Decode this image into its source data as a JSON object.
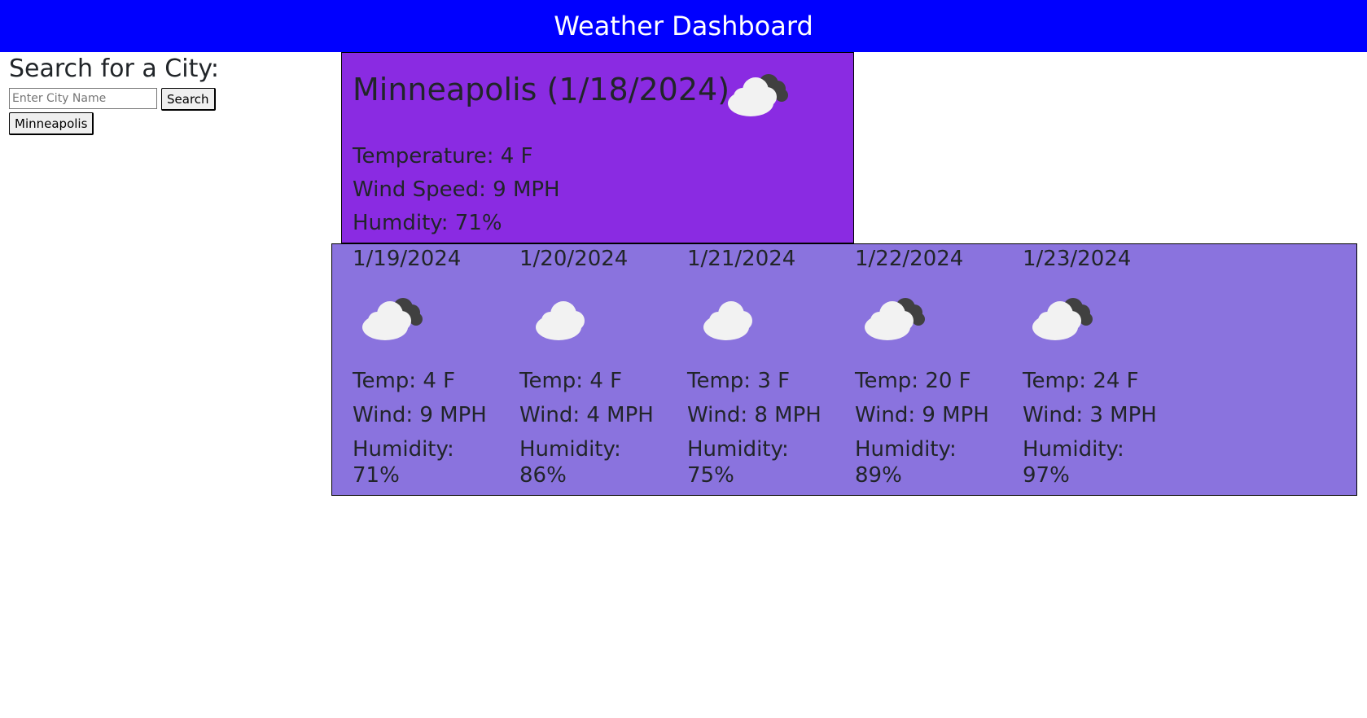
{
  "header": {
    "title": "Weather Dashboard"
  },
  "search": {
    "heading": "Search for a City:",
    "placeholder": "Enter City Name",
    "value": "",
    "button_label": "Search"
  },
  "history": [
    {
      "label": "Minneapolis"
    }
  ],
  "today": {
    "title": "Minneapolis (1/18/2024)",
    "icon": "broken-clouds-icon",
    "temperature": "Temperature: 4 F",
    "wind": "Wind Speed: 9 MPH",
    "humidity": "Humdity: 71%"
  },
  "forecast": [
    {
      "date": "1/19/2024",
      "icon": "broken-clouds-icon",
      "temp": "Temp: 4 F",
      "wind": "Wind: 9 MPH",
      "humidity": "Humidity: 71%"
    },
    {
      "date": "1/20/2024",
      "icon": "few-clouds-icon",
      "temp": "Temp: 4 F",
      "wind": "Wind: 4 MPH",
      "humidity": "Humidity: 86%"
    },
    {
      "date": "1/21/2024",
      "icon": "few-clouds-icon",
      "temp": "Temp: 3 F",
      "wind": "Wind: 8 MPH",
      "humidity": "Humidity: 75%"
    },
    {
      "date": "1/22/2024",
      "icon": "broken-clouds-icon",
      "temp": "Temp: 20 F",
      "wind": "Wind: 9 MPH",
      "humidity": "Humidity: 89%"
    },
    {
      "date": "1/23/2024",
      "icon": "broken-clouds-icon",
      "temp": "Temp: 24 F",
      "wind": "Wind: 3 MPH",
      "humidity": "Humidity: 97%"
    }
  ],
  "colors": {
    "header_bg": "#0000ff",
    "today_bg": "#8a2be2",
    "forecast_bg": "#8a73de"
  }
}
